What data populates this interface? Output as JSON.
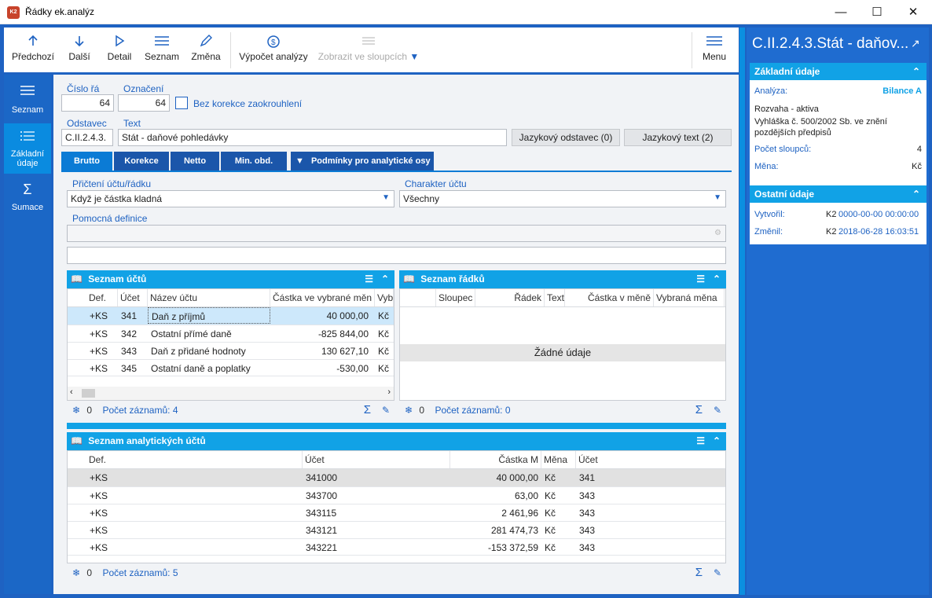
{
  "window": {
    "title": "Řádky ek.analýz",
    "icon_text": "K2"
  },
  "toolbar": {
    "prev": "Předchozí",
    "next": "Další",
    "detail": "Detail",
    "list": "Seznam",
    "change": "Změna",
    "calc": "Výpočet analýzy",
    "show_cols": "Zobrazit ve sloupcích",
    "menu": "Menu"
  },
  "sidebar": {
    "items": [
      {
        "label": "Seznam"
      },
      {
        "label": "Základní údaje"
      },
      {
        "label": "Sumace"
      }
    ]
  },
  "form": {
    "cislo_label": "Číslo řá",
    "cislo_value": "64",
    "oznaceni_label": "Označení",
    "oznaceni_value": "64",
    "bez_korekce_label": "Bez korekce zaokrouhlení",
    "odstavec_label": "Odstavec",
    "odstavec_value": "C.II.2.4.3.",
    "text_label": "Text",
    "text_value": "Stát - daňové pohledávky",
    "jazykovy_odstavec": "Jazykový odstavec (0)",
    "jazykovy_text": "Jazykový text (2)"
  },
  "tabs": [
    {
      "label": "Brutto"
    },
    {
      "label": "Korekce"
    },
    {
      "label": "Netto"
    },
    {
      "label": "Min. obd."
    },
    {
      "label": "Podmínky pro analytické osy"
    }
  ],
  "detail": {
    "pricteni_label": "Přičtení účtu/řádku",
    "pricteni_value": "Když je částka kladná",
    "charakter_label": "Charakter účtu",
    "charakter_value": "Všechny",
    "pomocna_label": "Pomocná definice"
  },
  "ucty": {
    "title": "Seznam účtů",
    "columns": [
      "Def.",
      "Účet",
      "Název účtu",
      "Částka ve vybrané měn",
      "Vyb"
    ],
    "rows": [
      [
        "+KS",
        "341",
        "Daň z příjmů",
        "40 000,00",
        "Kč"
      ],
      [
        "+KS",
        "342",
        "Ostatní přímé daně",
        "-825 844,00",
        "Kč"
      ],
      [
        "+KS",
        "343",
        "Daň z přidané hodnoty",
        "130 627,10",
        "Kč"
      ],
      [
        "+KS",
        "345",
        "Ostatní daně a poplatky",
        "-530,00",
        "Kč"
      ]
    ],
    "footer_count": "0",
    "footer_label": "Počet záznamů: 4"
  },
  "radky": {
    "title": "Seznam řádků",
    "columns": [
      "Sloupec",
      "Řádek",
      "Text",
      "Částka v měně",
      "Vybraná měna"
    ],
    "empty": "Žádné údaje",
    "footer_count": "0",
    "footer_label": "Počet záznamů: 0"
  },
  "analyticke": {
    "title": "Seznam analytických účtů",
    "columns": [
      "Def.",
      "Účet",
      "Částka M",
      "Měna",
      "Účet"
    ],
    "rows": [
      [
        "+KS",
        "341000",
        "40 000,00",
        "Kč",
        "341"
      ],
      [
        "+KS",
        "343700",
        "63,00",
        "Kč",
        "343"
      ],
      [
        "+KS",
        "343115",
        "2 461,96",
        "Kč",
        "343"
      ],
      [
        "+KS",
        "343121",
        "281 474,73",
        "Kč",
        "343"
      ],
      [
        "+KS",
        "343221",
        "-153 372,59",
        "Kč",
        "343"
      ]
    ],
    "footer_count": "0",
    "footer_label": "Počet záznamů: 5"
  },
  "right": {
    "title": "C.II.2.4.3.Stát - daňov...",
    "zakladni_title": "Základní údaje",
    "analyza_label": "Analýza:",
    "analyza_value": "Bilance A",
    "desc1": "Rozvaha - aktiva",
    "desc2": "Vyhláška č. 500/2002 Sb. ve znění pozdějších předpisů",
    "pocet_label": "Počet sloupců:",
    "pocet_value": "4",
    "mena_label": "Měna:",
    "mena_value": "Kč",
    "ostatni_title": "Ostatní údaje",
    "vytvoril_label": "Vytvořil:",
    "vytvoril_user": "K2",
    "vytvoril_date": "0000-00-00 00:00:00",
    "zmenil_label": "Změnil:",
    "zmenil_user": "K2",
    "zmenil_date": "2018-06-28 16:03:51"
  },
  "colors": {
    "accent": "#11a2e6",
    "frame": "#1e62c2",
    "selected_row": "#cde8fb"
  }
}
